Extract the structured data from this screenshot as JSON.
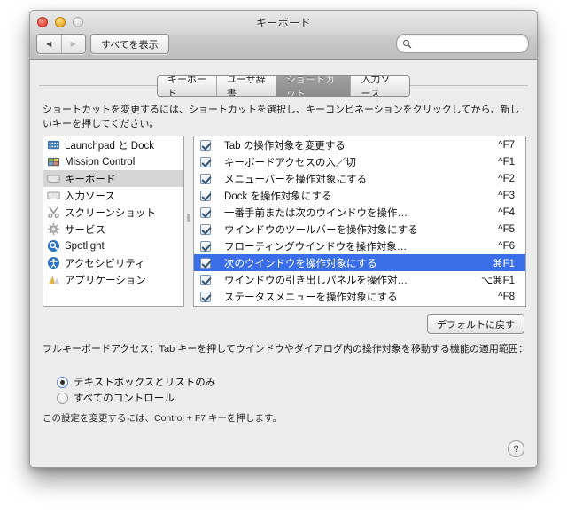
{
  "window": {
    "title": "キーボード",
    "traffic_lights": [
      "close",
      "minimize",
      "zoom"
    ]
  },
  "toolbar": {
    "back_glyph": "◀",
    "forward_glyph": "▶",
    "show_all_label": "すべてを表示",
    "search_value": "",
    "search_placeholder": ""
  },
  "tabs": [
    {
      "label": "キーボード",
      "active": false
    },
    {
      "label": "ユーザ辞書",
      "active": false
    },
    {
      "label": "ショートカット",
      "active": true
    },
    {
      "label": "入力ソース",
      "active": false
    }
  ],
  "instruction": "ショートカットを変更するには、ショートカットを選択し、キーコンビネーションをクリックしてから、新しいキーを押してください。",
  "sidebar": {
    "items": [
      {
        "label": "Launchpad と Dock",
        "icon": "launchpad-icon",
        "selected": false
      },
      {
        "label": "Mission Control",
        "icon": "mission-control-icon",
        "selected": false
      },
      {
        "label": "キーボード",
        "icon": "keyboard-icon",
        "selected": true
      },
      {
        "label": "入力ソース",
        "icon": "input-sources-icon",
        "selected": false
      },
      {
        "label": "スクリーンショット",
        "icon": "screenshot-icon",
        "selected": false
      },
      {
        "label": "サービス",
        "icon": "services-gear-icon",
        "selected": false
      },
      {
        "label": "Spotlight",
        "icon": "spotlight-icon",
        "selected": false
      },
      {
        "label": "アクセシビリティ",
        "icon": "accessibility-icon",
        "selected": false
      },
      {
        "label": "アプリケーション",
        "icon": "applications-icon",
        "selected": false
      }
    ]
  },
  "shortcuts": {
    "rows": [
      {
        "checked": true,
        "label": "Tab の操作対象を変更する",
        "key": "^F7",
        "selected": false
      },
      {
        "checked": true,
        "label": "キーボードアクセスの入／切",
        "key": "^F1",
        "selected": false
      },
      {
        "checked": true,
        "label": "メニューバーを操作対象にする",
        "key": "^F2",
        "selected": false
      },
      {
        "checked": true,
        "label": "Dock を操作対象にする",
        "key": "^F3",
        "selected": false
      },
      {
        "checked": true,
        "label": "一番手前または次のウインドウを操作…",
        "key": "^F4",
        "selected": false
      },
      {
        "checked": true,
        "label": "ウインドウのツールバーを操作対象にする",
        "key": "^F5",
        "selected": false
      },
      {
        "checked": true,
        "label": "フローティングウインドウを操作対象…",
        "key": "^F6",
        "selected": false
      },
      {
        "checked": true,
        "label": "次のウインドウを操作対象にする",
        "key": "⌘F1",
        "selected": true
      },
      {
        "checked": true,
        "label": "ウインドウの引き出しパネルを操作対…",
        "key": "⌥⌘F1",
        "selected": false
      },
      {
        "checked": true,
        "label": "ステータスメニューを操作対象にする",
        "key": "^F8",
        "selected": false
      }
    ]
  },
  "restore_defaults_label": "デフォルトに戻す",
  "full_keyboard_access": {
    "description": "フルキーボードアクセス：Tab キーを押してウインドウやダイアログ内の操作対象を移動する機能の適用範囲：",
    "options": [
      {
        "label": "テキストボックスとリストのみ",
        "selected": true
      },
      {
        "label": "すべてのコントロール",
        "selected": false
      }
    ],
    "hint": "この設定を変更するには、Control + F7 キーを押します。"
  },
  "help_label": "?",
  "colors": {
    "selection_blue": "#3a6ee8",
    "inactive_selection": "#d5d5d5",
    "window_bg": "#ececec"
  }
}
